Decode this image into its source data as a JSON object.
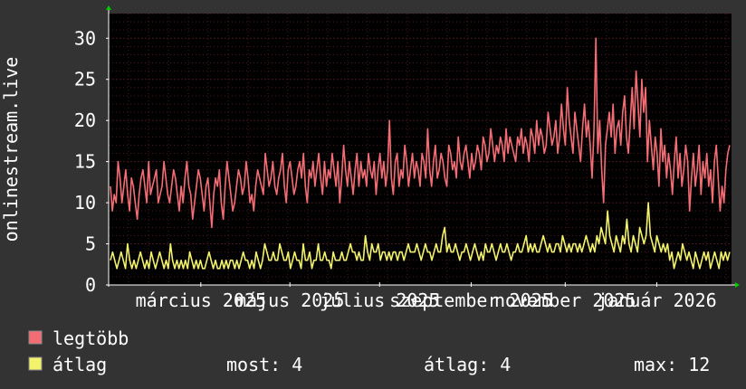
{
  "chart_data": {
    "type": "line",
    "ylabel": "onlinestream.live",
    "ylim": [
      0,
      33
    ],
    "yticks": [
      0,
      5,
      10,
      15,
      20,
      25,
      30
    ],
    "grid": true,
    "x_tick_labels": [
      "március 2025",
      "május 2025",
      "július 2025",
      "szeptember 2025",
      "november 2025",
      "január 2026"
    ],
    "colors": {
      "background": "#333333",
      "plot": "#000000",
      "grid": "#4a1818",
      "max_series": "#f46d75",
      "avg_series": "#f3f36b",
      "axis": "#ffffff",
      "arrow": "#00cc00"
    },
    "series": [
      {
        "name": "legtöbb",
        "color": "#f46d75",
        "values": [
          12,
          9,
          11,
          10,
          15,
          13,
          10,
          12,
          14,
          11,
          9,
          13,
          12,
          10,
          8,
          11,
          13,
          14,
          12,
          10,
          15,
          11,
          12,
          13,
          14,
          10,
          11,
          12,
          15,
          13,
          11,
          10,
          12,
          14,
          13,
          11,
          9,
          12,
          10,
          13,
          15,
          12,
          11,
          8,
          10,
          12,
          14,
          13,
          11,
          9,
          12,
          13,
          10,
          7,
          11,
          13,
          12,
          14,
          10,
          8,
          12,
          15,
          13,
          11,
          9,
          10,
          12,
          14,
          13,
          11,
          12,
          15,
          13,
          10,
          11,
          9,
          12,
          14,
          13,
          12,
          11,
          16,
          14,
          12,
          13,
          15,
          12,
          11,
          13,
          14,
          16,
          12,
          10,
          14,
          15,
          13,
          11,
          12,
          14,
          15,
          13,
          16,
          12,
          10,
          14,
          13,
          15,
          12,
          14,
          16,
          13,
          11,
          15,
          12,
          14,
          13,
          16,
          14,
          12,
          15,
          10,
          13,
          17,
          14,
          12,
          15,
          13,
          11,
          14,
          16,
          12,
          15,
          13,
          14,
          12,
          16,
          14,
          13,
          15,
          11,
          14,
          16,
          13,
          15,
          12,
          14,
          20,
          13,
          11,
          15,
          16,
          12,
          14,
          13,
          17,
          15,
          12,
          14,
          16,
          13,
          15,
          14,
          12,
          16,
          15,
          13,
          19,
          14,
          12,
          15,
          17,
          13,
          14,
          16,
          15,
          13,
          12,
          17,
          16,
          14,
          15,
          13,
          18,
          15,
          14,
          16,
          17,
          15,
          13,
          16,
          14,
          15,
          17,
          16,
          14,
          18,
          17,
          15,
          16,
          19,
          17,
          15,
          17,
          16,
          18,
          17,
          15,
          19,
          16,
          18,
          17,
          16,
          15,
          18,
          17,
          19,
          16,
          18,
          17,
          15,
          19,
          18,
          16,
          20,
          17,
          19,
          18,
          16,
          17,
          21,
          19,
          17,
          18,
          20,
          16,
          18,
          22,
          19,
          17,
          24,
          20,
          18,
          16,
          21,
          19,
          17,
          15,
          19,
          22,
          18,
          20,
          17,
          13,
          19,
          30,
          16,
          20,
          14,
          10,
          17,
          19,
          21,
          18,
          22,
          16,
          19,
          20,
          17,
          21,
          23,
          18,
          16,
          20,
          24,
          19,
          26,
          22,
          18,
          25,
          21,
          24,
          15,
          20,
          17,
          14,
          18,
          16,
          12,
          19,
          15,
          17,
          13,
          16,
          14,
          11,
          15,
          18,
          13,
          16,
          12,
          14,
          17,
          15,
          9,
          13,
          16,
          12,
          14,
          17,
          11,
          15,
          13,
          16,
          12,
          14,
          10,
          15,
          17,
          13,
          9,
          12,
          10,
          14,
          16,
          17
        ]
      },
      {
        "name": "átlag",
        "color": "#f3f36b",
        "values": [
          3,
          4,
          3,
          2,
          3,
          4,
          3,
          2,
          5,
          3,
          2,
          3,
          2,
          3,
          4,
          3,
          2,
          3,
          2,
          4,
          3,
          2,
          3,
          4,
          3,
          2,
          3,
          2,
          5,
          3,
          2,
          3,
          2,
          3,
          2,
          3,
          2,
          4,
          3,
          2,
          3,
          2,
          3,
          2,
          2,
          3,
          4,
          3,
          2,
          3,
          2,
          2,
          3,
          2,
          3,
          2,
          3,
          3,
          2,
          3,
          2,
          3,
          4,
          3,
          3,
          2,
          3,
          2,
          4,
          3,
          2,
          3,
          5,
          4,
          3,
          3,
          4,
          3,
          3,
          5,
          4,
          3,
          3,
          4,
          2,
          3,
          4,
          3,
          3,
          2,
          5,
          3,
          3,
          4,
          2,
          3,
          3,
          5,
          3,
          3,
          4,
          3,
          3,
          2,
          4,
          3,
          3,
          3,
          4,
          3,
          3,
          4,
          5,
          4,
          4,
          3,
          4,
          3,
          3,
          6,
          4,
          3,
          5,
          4,
          4,
          5,
          3,
          4,
          4,
          3,
          4,
          3,
          4,
          4,
          3,
          4,
          4,
          3,
          4,
          5,
          4,
          4,
          4,
          5,
          4,
          3,
          4,
          5,
          4,
          4,
          3,
          4,
          5,
          4,
          4,
          6,
          7,
          4,
          5,
          4,
          4,
          5,
          4,
          3,
          4,
          4,
          5,
          4,
          3,
          4,
          5,
          4,
          3,
          4,
          3,
          5,
          4,
          4,
          5,
          4,
          3,
          4,
          5,
          4,
          4,
          5,
          4,
          3,
          4,
          4,
          5,
          4,
          4,
          5,
          6,
          4,
          5,
          4,
          5,
          4,
          4,
          5,
          6,
          5,
          4,
          5,
          4,
          4,
          5,
          5,
          4,
          6,
          5,
          4,
          5,
          4,
          5,
          5,
          4,
          5,
          4,
          5,
          6,
          5,
          4,
          5,
          4,
          6,
          5,
          7,
          6,
          5,
          9,
          6,
          5,
          4,
          6,
          5,
          4,
          6,
          5,
          8,
          5,
          4,
          6,
          5,
          4,
          7,
          6,
          5,
          6,
          10,
          6,
          5,
          4,
          6,
          5,
          4,
          5,
          4,
          5,
          3,
          4,
          2,
          3,
          4,
          3,
          5,
          4,
          3,
          4,
          3,
          2,
          4,
          3,
          2,
          3,
          4,
          3,
          4,
          2,
          3,
          4,
          3,
          2,
          4,
          3,
          4,
          3,
          4
        ]
      }
    ]
  },
  "legend": {
    "max_label": "legtöbb",
    "avg_label": "átlag"
  },
  "stats": {
    "now": "most: 4",
    "avg": "átlag: 4",
    "max": "max: 12"
  }
}
